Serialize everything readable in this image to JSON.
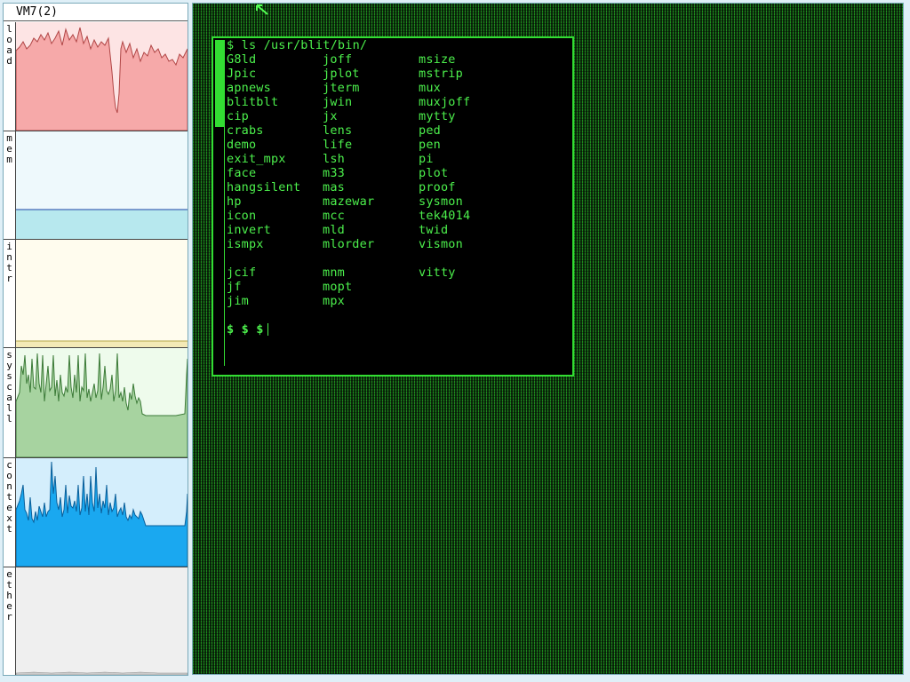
{
  "stats_panel": {
    "title": "VM7(2)",
    "graphs": [
      {
        "label": "load",
        "fill": "#f6a9a9",
        "line": "#b04545",
        "bg": "#fde4e4"
      },
      {
        "label": "mem",
        "fill": "#b7e8ee",
        "line": "#5a7fc0",
        "bg": "#eef9fc"
      },
      {
        "label": "intr",
        "fill": "#f3e9b6",
        "line": "#b4a64a",
        "bg": "#fffcee"
      },
      {
        "label": "syscall",
        "fill": "#a7d3a0",
        "line": "#3b7a37",
        "bg": "#eefbec"
      },
      {
        "label": "context",
        "fill": "#1aa8f0",
        "line": "#0a5f9a",
        "bg": "#d4eefc"
      },
      {
        "label": "ether",
        "fill": "#eeeeee",
        "line": "#888888",
        "bg": "#efefef"
      }
    ]
  },
  "terminal": {
    "command": "$ ls /usr/blit/bin/",
    "rows": [
      [
        "G8ld",
        "joff",
        "msize"
      ],
      [
        "Jpic",
        "jplot",
        "mstrip"
      ],
      [
        "apnews",
        "jterm",
        "mux"
      ],
      [
        "blitblt",
        "jwin",
        "muxjoff"
      ],
      [
        "cip",
        "jx",
        "mytty"
      ],
      [
        "crabs",
        "lens",
        "ped"
      ],
      [
        "demo",
        "life",
        "pen"
      ],
      [
        "exit_mpx",
        "lsh",
        "pi"
      ],
      [
        "face",
        "m33",
        "plot"
      ],
      [
        "hangsilent",
        "mas",
        "proof"
      ],
      [
        "hp",
        "mazewar",
        "sysmon"
      ],
      [
        "icon",
        "mcc",
        "tek4014"
      ],
      [
        "invert",
        "mld",
        "twid"
      ],
      [
        "ismpx",
        "mlorder",
        "vismon"
      ],
      [
        "",
        "",
        ""
      ],
      [
        "jcif",
        "mnm",
        "vitty"
      ],
      [
        "jf",
        "mopt",
        ""
      ],
      [
        "jim",
        "mpx",
        ""
      ]
    ],
    "prompt": "$ $ $",
    "text_color": "#4cf04c",
    "border_color": "#33dd33"
  },
  "desktop": {
    "pattern_color": "#1e8c1e"
  }
}
